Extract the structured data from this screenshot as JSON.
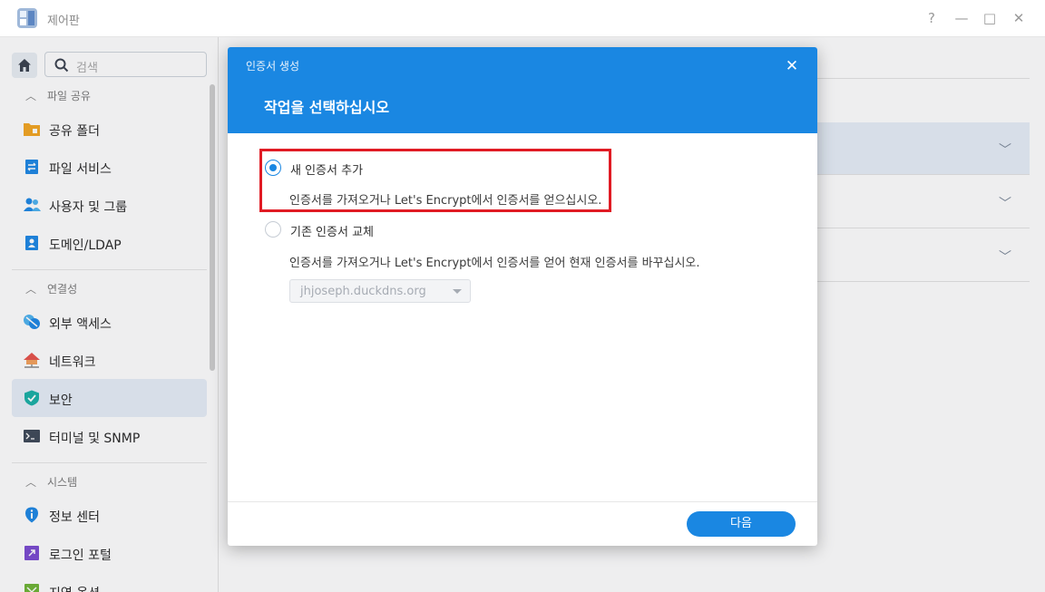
{
  "window": {
    "title": "제어판",
    "controls": {
      "help": "?",
      "minimize": "—",
      "maximize": "□",
      "close": "✕"
    }
  },
  "sidebar": {
    "search_placeholder": "검색",
    "sections": [
      {
        "label": "파일 공유",
        "items": [
          "공유 폴더",
          "파일 서비스",
          "사용자 및 그룹",
          "도메인/LDAP"
        ]
      },
      {
        "label": "연결성",
        "items": [
          "외부 액세스",
          "네트워크",
          "보안",
          "터미널 및 SNMP"
        ]
      },
      {
        "label": "시스템",
        "items": [
          "정보 센터",
          "로그인 포털",
          "지역 옵션"
        ]
      }
    ],
    "active_item": "보안"
  },
  "dialog": {
    "window_label": "인증서 생성",
    "title": "작업을 선택하십시오",
    "options": [
      {
        "label": "새 인증서 추가",
        "description": "인증서를 가져오거나 Let's Encrypt에서 인증서를 얻으십시오.",
        "selected": true
      },
      {
        "label": "기존 인증서 교체",
        "description": "인증서를 가져오거나 Let's Encrypt에서 인증서를 얻어 현재 인증서를 바꾸십시오.",
        "selected": false
      }
    ],
    "select_value": "jhjoseph.duckdns.org",
    "next_button": "다음",
    "close": "✕"
  },
  "colors": {
    "accent": "#1a87e2",
    "highlight_border": "#e01b24",
    "active_nav": "#e6eef8"
  }
}
